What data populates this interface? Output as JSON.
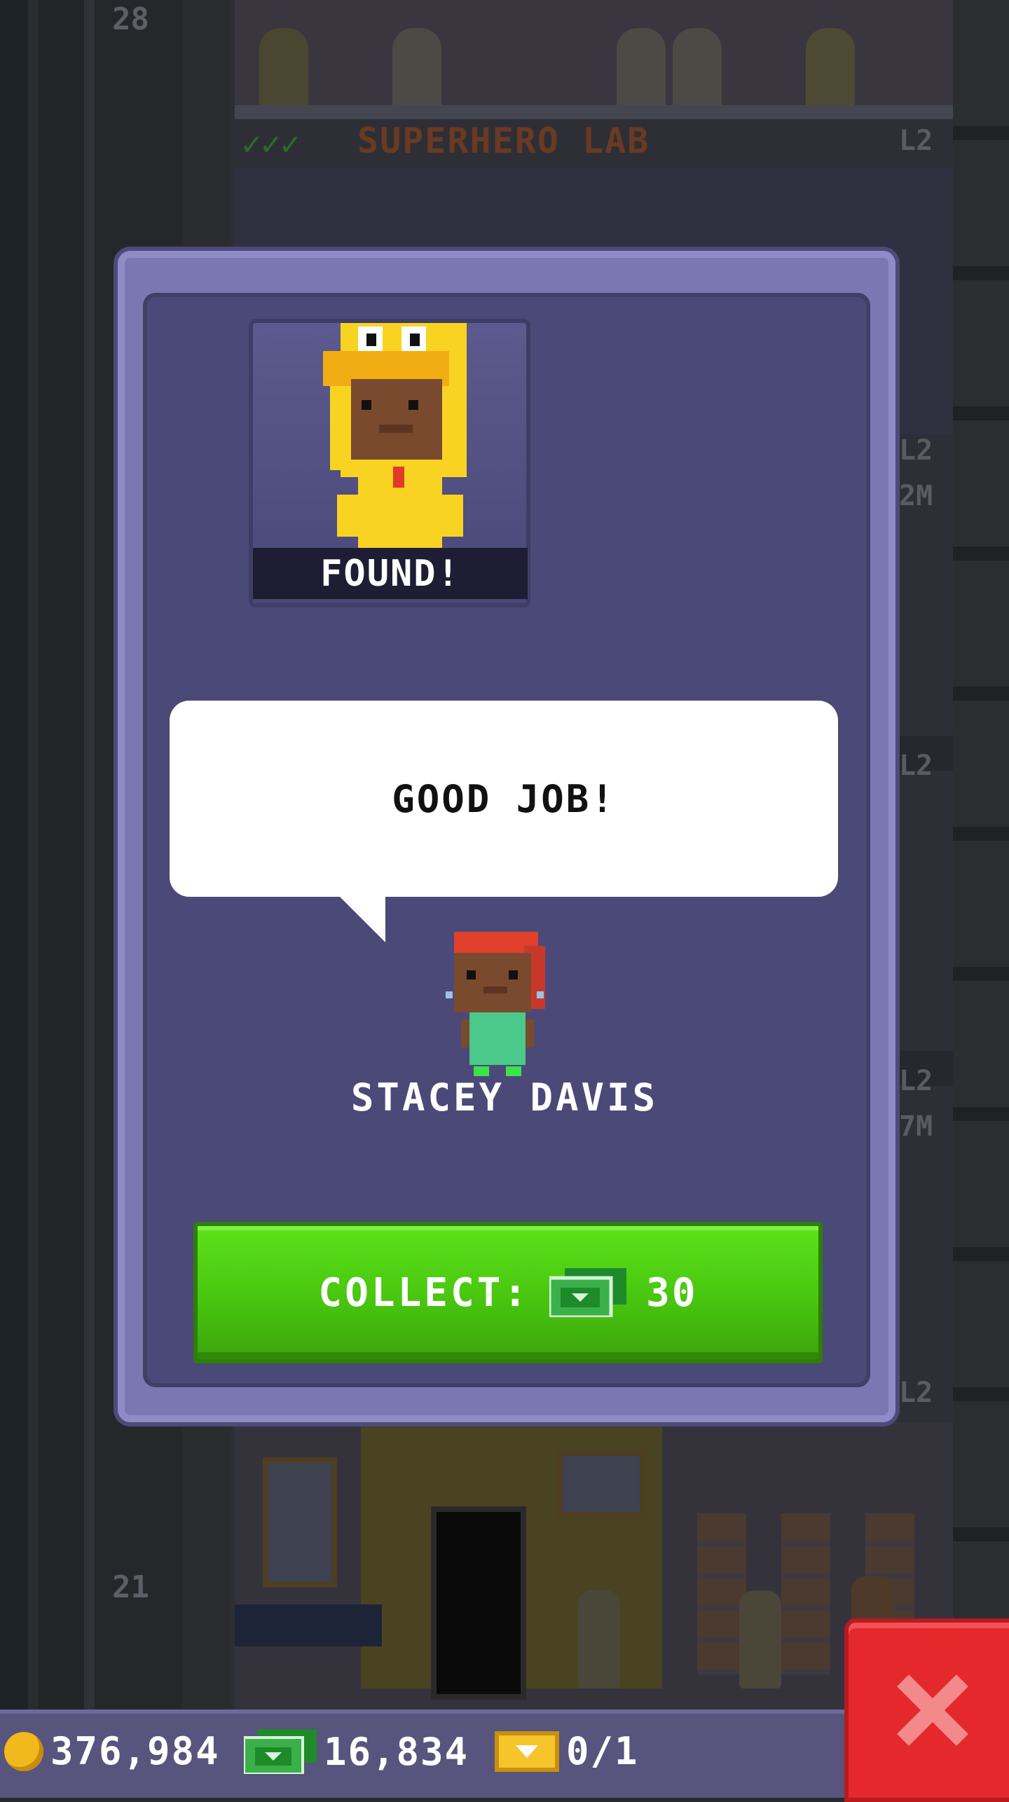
{
  "background": {
    "floors": [
      {
        "number": "28",
        "name": "SUPERHERO LAB",
        "level": "L2"
      },
      {
        "number": "21",
        "level": "L2"
      }
    ],
    "side_labels": [
      "L2",
      "2M",
      "L2",
      "L2",
      "7M",
      "L2"
    ]
  },
  "modal": {
    "status": "FOUND!",
    "speech": "GOOD JOB!",
    "npc_name": "STACEY DAVIS",
    "collect_label": "COLLECT:",
    "collect_amount": "30"
  },
  "hud": {
    "coins": "376,984",
    "bux": "16,834",
    "tickets": "0/1"
  },
  "colors": {
    "modal_frame": "#7b77b3",
    "modal_panel": "#4b4977",
    "collect_green": "#4fd214",
    "close_red": "#e5282c",
    "hud_bar": "#57547d"
  },
  "icons": {
    "currency": "bux-cash-icon",
    "coin": "coin-icon",
    "ticket": "golden-ticket-icon",
    "close": "close-x-icon"
  }
}
